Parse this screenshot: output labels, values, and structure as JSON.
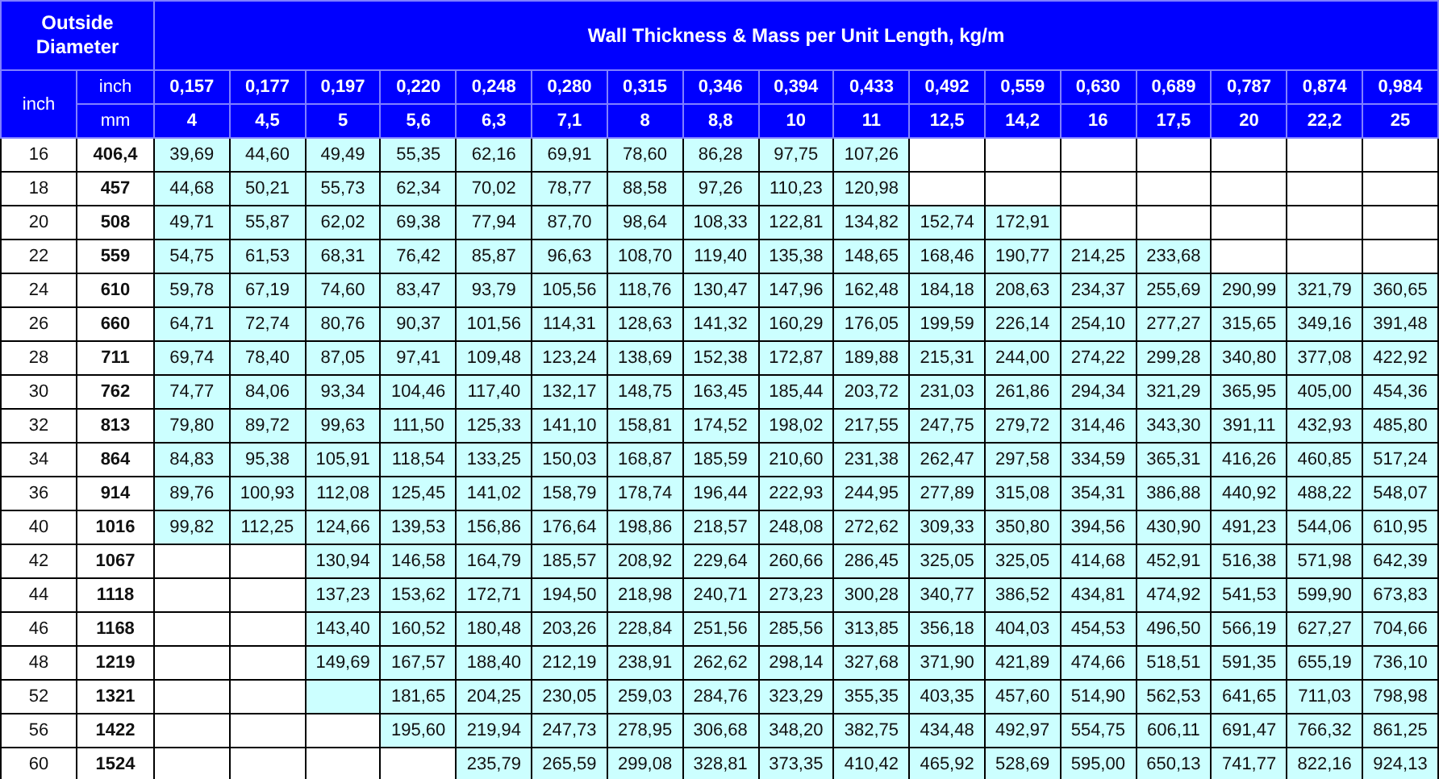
{
  "header": {
    "diameter_title": "Outside Diameter",
    "thickness_title": "Wall Thickness & Mass per Unit Length, kg/m",
    "diameter_unit": "inch",
    "inch_label": "inch",
    "mm_label": "mm",
    "thickness_inch": [
      "0,157",
      "0,177",
      "0,197",
      "0,220",
      "0,248",
      "0,280",
      "0,315",
      "0,346",
      "0,394",
      "0,433",
      "0,492",
      "0,559",
      "0,630",
      "0,689",
      "0,787",
      "0,874",
      "0,984"
    ],
    "thickness_mm": [
      "4",
      "4,5",
      "5",
      "5,6",
      "6,3",
      "7,1",
      "8",
      "8,8",
      "10",
      "11",
      "12,5",
      "14,2",
      "16",
      "17,5",
      "20",
      "22,2",
      "25"
    ]
  },
  "rows": [
    {
      "inch": "16",
      "mm": "406,4",
      "cells": [
        "39,69",
        "44,60",
        "49,49",
        "55,35",
        "62,16",
        "69,91",
        "78,60",
        "86,28",
        "97,75",
        "107,26",
        null,
        null,
        null,
        null,
        null,
        null,
        null
      ]
    },
    {
      "inch": "18",
      "mm": "457",
      "cells": [
        "44,68",
        "50,21",
        "55,73",
        "62,34",
        "70,02",
        "78,77",
        "88,58",
        "97,26",
        "110,23",
        "120,98",
        null,
        null,
        null,
        null,
        null,
        null,
        null
      ]
    },
    {
      "inch": "20",
      "mm": "508",
      "cells": [
        "49,71",
        "55,87",
        "62,02",
        "69,38",
        "77,94",
        "87,70",
        "98,64",
        "108,33",
        "122,81",
        "134,82",
        "152,74",
        "172,91",
        null,
        null,
        null,
        null,
        null
      ]
    },
    {
      "inch": "22",
      "mm": "559",
      "cells": [
        "54,75",
        "61,53",
        "68,31",
        "76,42",
        "85,87",
        "96,63",
        "108,70",
        "119,40",
        "135,38",
        "148,65",
        "168,46",
        "190,77",
        "214,25",
        "233,68",
        null,
        null,
        null
      ]
    },
    {
      "inch": "24",
      "mm": "610",
      "cells": [
        "59,78",
        "67,19",
        "74,60",
        "83,47",
        "93,79",
        "105,56",
        "118,76",
        "130,47",
        "147,96",
        "162,48",
        "184,18",
        "208,63",
        "234,37",
        "255,69",
        "290,99",
        "321,79",
        "360,65"
      ]
    },
    {
      "inch": "26",
      "mm": "660",
      "cells": [
        "64,71",
        "72,74",
        "80,76",
        "90,37",
        "101,56",
        "114,31",
        "128,63",
        "141,32",
        "160,29",
        "176,05",
        "199,59",
        "226,14",
        "254,10",
        "277,27",
        "315,65",
        "349,16",
        "391,48"
      ]
    },
    {
      "inch": "28",
      "mm": "711",
      "cells": [
        "69,74",
        "78,40",
        "87,05",
        "97,41",
        "109,48",
        "123,24",
        "138,69",
        "152,38",
        "172,87",
        "189,88",
        "215,31",
        "244,00",
        "274,22",
        "299,28",
        "340,80",
        "377,08",
        "422,92"
      ]
    },
    {
      "inch": "30",
      "mm": "762",
      "cells": [
        "74,77",
        "84,06",
        "93,34",
        "104,46",
        "117,40",
        "132,17",
        "148,75",
        "163,45",
        "185,44",
        "203,72",
        "231,03",
        "261,86",
        "294,34",
        "321,29",
        "365,95",
        "405,00",
        "454,36"
      ]
    },
    {
      "inch": "32",
      "mm": "813",
      "cells": [
        "79,80",
        "89,72",
        "99,63",
        "111,50",
        "125,33",
        "141,10",
        "158,81",
        "174,52",
        "198,02",
        "217,55",
        "247,75",
        "279,72",
        "314,46",
        "343,30",
        "391,11",
        "432,93",
        "485,80"
      ]
    },
    {
      "inch": "34",
      "mm": "864",
      "cells": [
        "84,83",
        "95,38",
        "105,91",
        "118,54",
        "133,25",
        "150,03",
        "168,87",
        "185,59",
        "210,60",
        "231,38",
        "262,47",
        "297,58",
        "334,59",
        "365,31",
        "416,26",
        "460,85",
        "517,24"
      ]
    },
    {
      "inch": "36",
      "mm": "914",
      "cells": [
        "89,76",
        "100,93",
        "112,08",
        "125,45",
        "141,02",
        "158,79",
        "178,74",
        "196,44",
        "222,93",
        "244,95",
        "277,89",
        "315,08",
        "354,31",
        "386,88",
        "440,92",
        "488,22",
        "548,07"
      ]
    },
    {
      "inch": "40",
      "mm": "1016",
      "cells": [
        "99,82",
        "112,25",
        "124,66",
        "139,53",
        "156,86",
        "176,64",
        "198,86",
        "218,57",
        "248,08",
        "272,62",
        "309,33",
        "350,80",
        "394,56",
        "430,90",
        "491,23",
        "544,06",
        "610,95"
      ]
    },
    {
      "inch": "42",
      "mm": "1067",
      "cells": [
        null,
        null,
        "130,94",
        "146,58",
        "164,79",
        "185,57",
        "208,92",
        "229,64",
        "260,66",
        "286,45",
        "325,05",
        "325,05",
        "414,68",
        "452,91",
        "516,38",
        "571,98",
        "642,39"
      ]
    },
    {
      "inch": "44",
      "mm": "1118",
      "cells": [
        null,
        null,
        "137,23",
        "153,62",
        "172,71",
        "194,50",
        "218,98",
        "240,71",
        "273,23",
        "300,28",
        "340,77",
        "386,52",
        "434,81",
        "474,92",
        "541,53",
        "599,90",
        "673,83"
      ]
    },
    {
      "inch": "46",
      "mm": "1168",
      "cells": [
        null,
        null,
        "143,40",
        "160,52",
        "180,48",
        "203,26",
        "228,84",
        "251,56",
        "285,56",
        "313,85",
        "356,18",
        "404,03",
        "454,53",
        "496,50",
        "566,19",
        "627,27",
        "704,66"
      ]
    },
    {
      "inch": "48",
      "mm": "1219",
      "cells": [
        null,
        null,
        "149,69",
        "167,57",
        "188,40",
        "212,19",
        "238,91",
        "262,62",
        "298,14",
        "327,68",
        "371,90",
        "421,89",
        "474,66",
        "518,51",
        "591,35",
        "655,19",
        "736,10"
      ]
    },
    {
      "inch": "52",
      "mm": "1321",
      "cells": [
        null,
        null,
        {
          "shaded": true
        },
        "181,65",
        "204,25",
        "230,05",
        "259,03",
        "284,76",
        "323,29",
        "355,35",
        "403,35",
        "457,60",
        "514,90",
        "562,53",
        "641,65",
        "711,03",
        "798,98"
      ]
    },
    {
      "inch": "56",
      "mm": "1422",
      "cells": [
        null,
        null,
        null,
        "195,60",
        "219,94",
        "247,73",
        "278,95",
        "306,68",
        "348,20",
        "382,75",
        "434,48",
        "492,97",
        "554,75",
        "606,11",
        "691,47",
        "766,32",
        "861,25"
      ]
    },
    {
      "inch": "60",
      "mm": "1524",
      "cells": [
        null,
        null,
        null,
        null,
        "235,79",
        "265,59",
        "299,08",
        "328,81",
        "373,35",
        "410,42",
        "465,92",
        "528,69",
        "595,00",
        "650,13",
        "741,77",
        "822,16",
        "924,13"
      ]
    }
  ]
}
